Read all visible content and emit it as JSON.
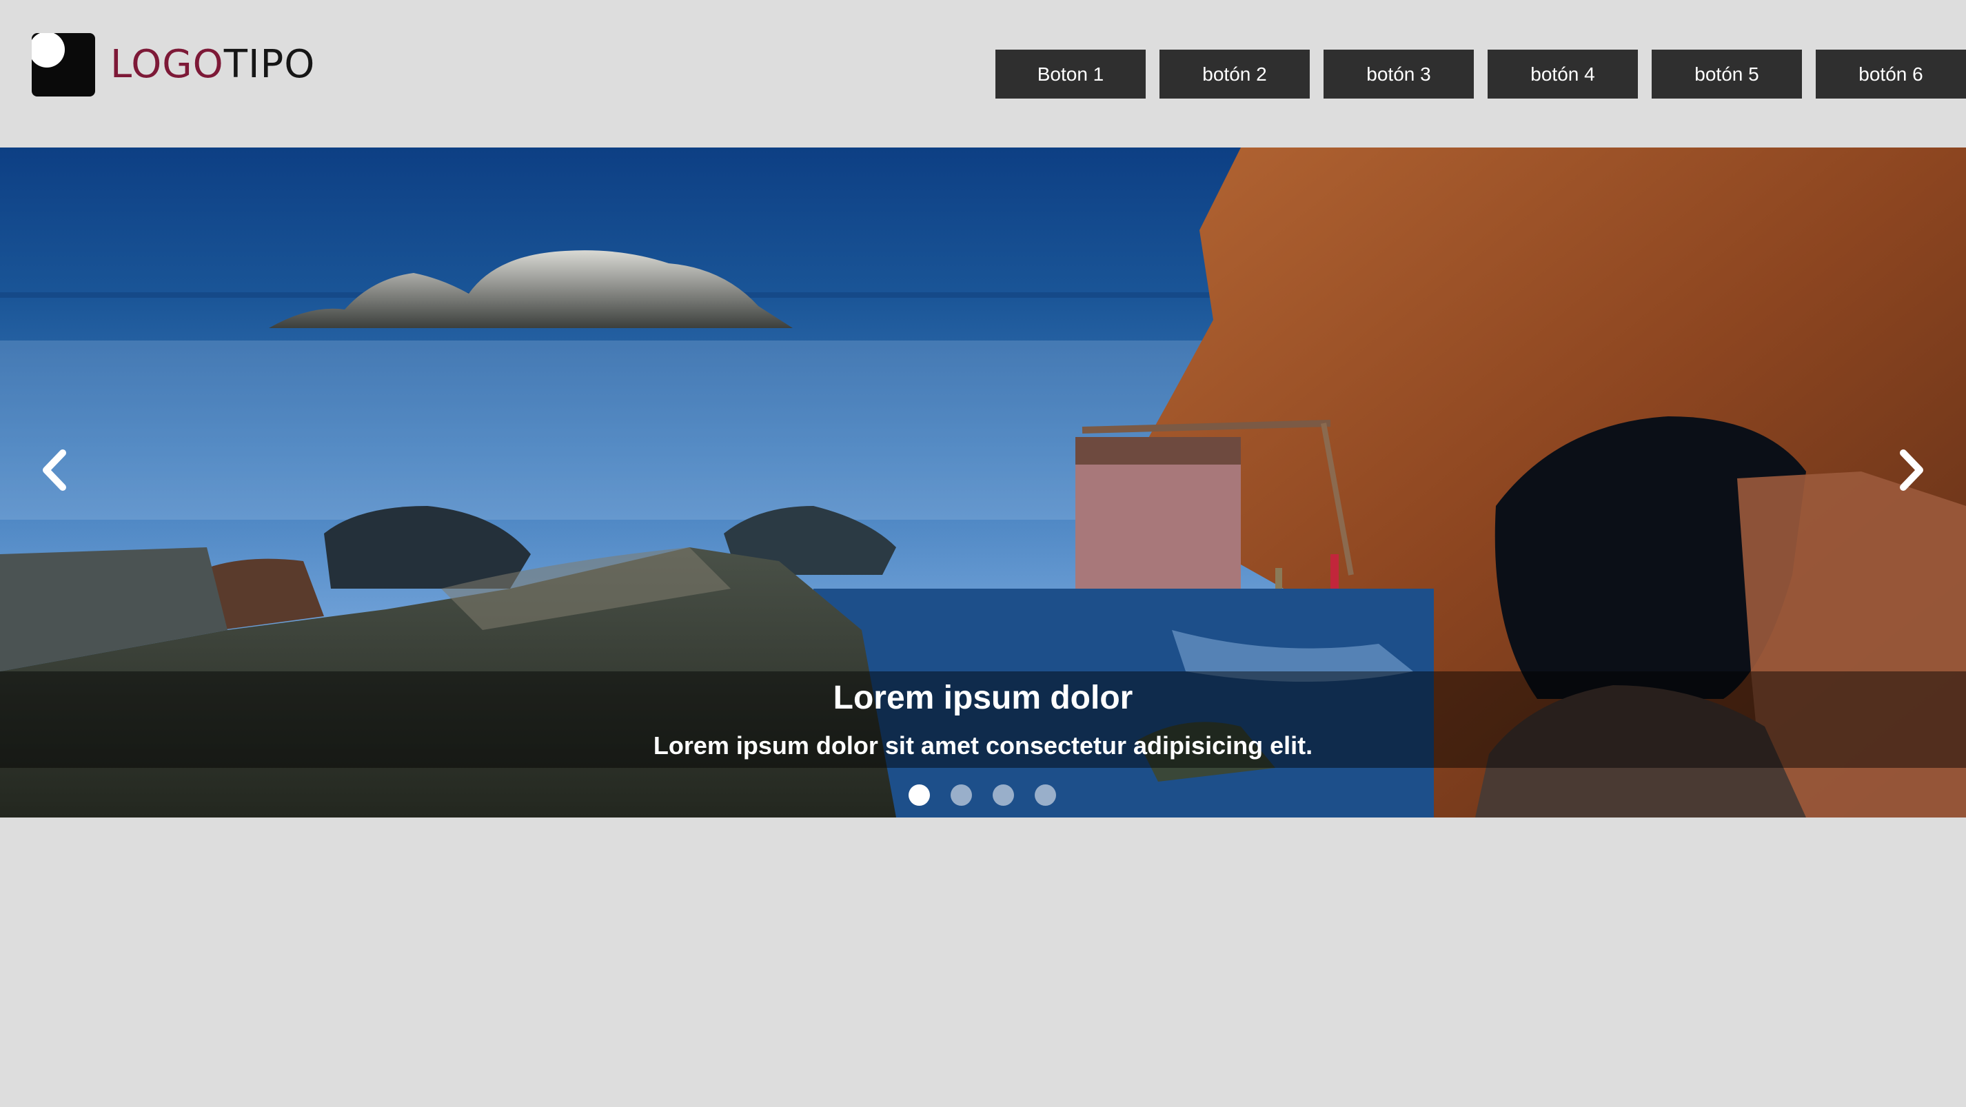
{
  "logo": {
    "text_accent": "LOGO",
    "text_rest": "TIPO",
    "accent_color": "#7d1937"
  },
  "nav": {
    "buttons": [
      {
        "label": "Boton 1"
      },
      {
        "label": "botón 2"
      },
      {
        "label": "botón 3"
      },
      {
        "label": "botón 4"
      },
      {
        "label": "botón 5"
      },
      {
        "label": "botón 6"
      }
    ]
  },
  "slider": {
    "caption_title": "Lorem ipsum dolor",
    "caption_text": "Lorem ipsum dolor sit amet consectetur adipisicing elit.",
    "prev_icon": "chevron-left-icon",
    "next_icon": "chevron-right-icon",
    "dot_count": 4,
    "active_dot": 1
  }
}
